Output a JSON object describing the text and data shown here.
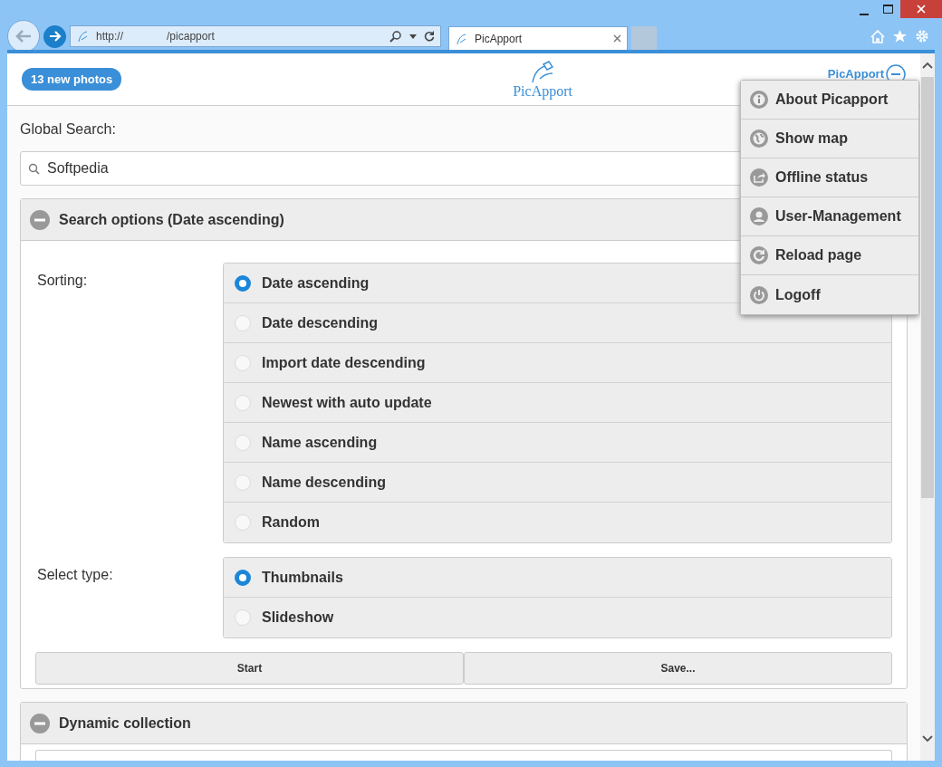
{
  "browser": {
    "address_scheme": "http://",
    "address_path": "/picapport",
    "tab": {
      "label": "PicApport",
      "selected": true
    }
  },
  "header": {
    "badge": "13 new photos",
    "logo": "PicApport",
    "user_link": "PicApport"
  },
  "menu": [
    {
      "label": "About Picapport",
      "kind": "info"
    },
    {
      "label": "Show map",
      "kind": "globe"
    },
    {
      "label": "Offline status",
      "kind": "share"
    },
    {
      "label": "User-Management",
      "kind": "user"
    },
    {
      "label": "Reload page",
      "kind": "reload"
    },
    {
      "label": "Logoff",
      "kind": "power"
    }
  ],
  "search": {
    "label": "Global Search:",
    "value": "Softpedia"
  },
  "search_options": {
    "title": "Search options (Date ascending)",
    "expanded": true,
    "sorting_label": "Sorting:",
    "sorting": [
      {
        "label": "Date ascending",
        "selected": true
      },
      {
        "label": "Date descending",
        "selected": false
      },
      {
        "label": "Import date descending",
        "selected": false
      },
      {
        "label": "Newest with auto update",
        "selected": false
      },
      {
        "label": "Name ascending",
        "selected": false
      },
      {
        "label": "Name descending",
        "selected": false
      },
      {
        "label": "Random",
        "selected": false
      }
    ],
    "type_label": "Select type:",
    "types": [
      {
        "label": "Thumbnails",
        "selected": true
      },
      {
        "label": "Slideshow",
        "selected": false
      }
    ],
    "buttons": [
      "Start",
      "Save..."
    ]
  },
  "dynamic_collection": {
    "title": "Dynamic collection",
    "expanded": true
  }
}
